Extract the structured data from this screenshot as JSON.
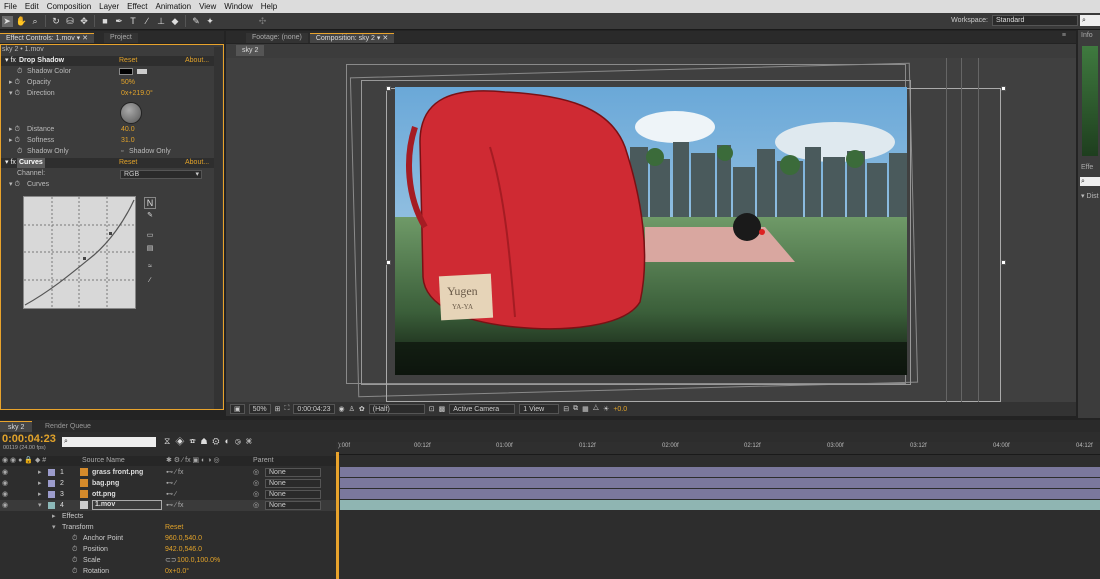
{
  "menu": [
    "File",
    "Edit",
    "Composition",
    "Layer",
    "Effect",
    "Animation",
    "View",
    "Window",
    "Help"
  ],
  "workspace": {
    "label": "Workspace:",
    "value": "Standard"
  },
  "effect_controls": {
    "tab_label": "Effect Controls: 1.mov",
    "project_tab": "Project",
    "breadcrumb": "sky 2 • 1.mov",
    "drop_shadow": {
      "name": "Drop Shadow",
      "reset": "Reset",
      "about": "About...",
      "shadow_color": "Shadow Color",
      "opacity_lbl": "Opacity",
      "opacity": "50%",
      "direction_lbl": "Direction",
      "direction": "0x+219.0°",
      "distance_lbl": "Distance",
      "distance": "40.0",
      "softness_lbl": "Softness",
      "softness": "31.0",
      "shadow_only_lbl": "Shadow Only",
      "shadow_only": "Shadow Only"
    },
    "curves": {
      "name": "Curves",
      "reset": "Reset",
      "about": "About...",
      "channel_lbl": "Channel:",
      "channel": "RGB",
      "curves_lbl": "Curves"
    }
  },
  "composition": {
    "footage_tab": "Footage: (none)",
    "comp_tab": "Composition: sky 2",
    "comp_subtab": "sky 2",
    "zoom": "50%",
    "timecode": "0:00:04:23",
    "resolution": "(Half)",
    "camera": "Active Camera",
    "views": "1 View",
    "exposure": "+0.0"
  },
  "image_text": {
    "sign_line1": "Yugen",
    "sign_line2": "YA-YA"
  },
  "right_panels": {
    "info": "Info",
    "effects": "Effe",
    "dist": "Dist"
  },
  "timeline": {
    "tab": "sky 2",
    "render_tab": "Render Queue",
    "timecode": "0:00:04:23",
    "frame_info": "00119 (24.00 fps)",
    "source_col": "Source Name",
    "parent_col": "Parent",
    "ruler": [
      "):00f",
      "00:12f",
      "01:00f",
      "01:12f",
      "02:00f",
      "02:12f",
      "03:00f",
      "03:12f",
      "04:00f",
      "04:12f"
    ],
    "layers": [
      {
        "num": "1",
        "name": "grass front.png",
        "parent": "None"
      },
      {
        "num": "2",
        "name": "bag.png",
        "parent": "None"
      },
      {
        "num": "3",
        "name": "ott.png",
        "parent": "None"
      },
      {
        "num": "4",
        "name": "1.mov",
        "parent": "None"
      }
    ],
    "props": {
      "effects": "Effects",
      "transform": "Transform",
      "reset": "Reset",
      "anchor_lbl": "Anchor Point",
      "anchor": "960.0,540.0",
      "position_lbl": "Position",
      "position": "942.0,546.0",
      "scale_lbl": "Scale",
      "scale": "100.0,100.0%",
      "rotation_lbl": "Rotation",
      "rotation": "0x+0.0°"
    }
  }
}
